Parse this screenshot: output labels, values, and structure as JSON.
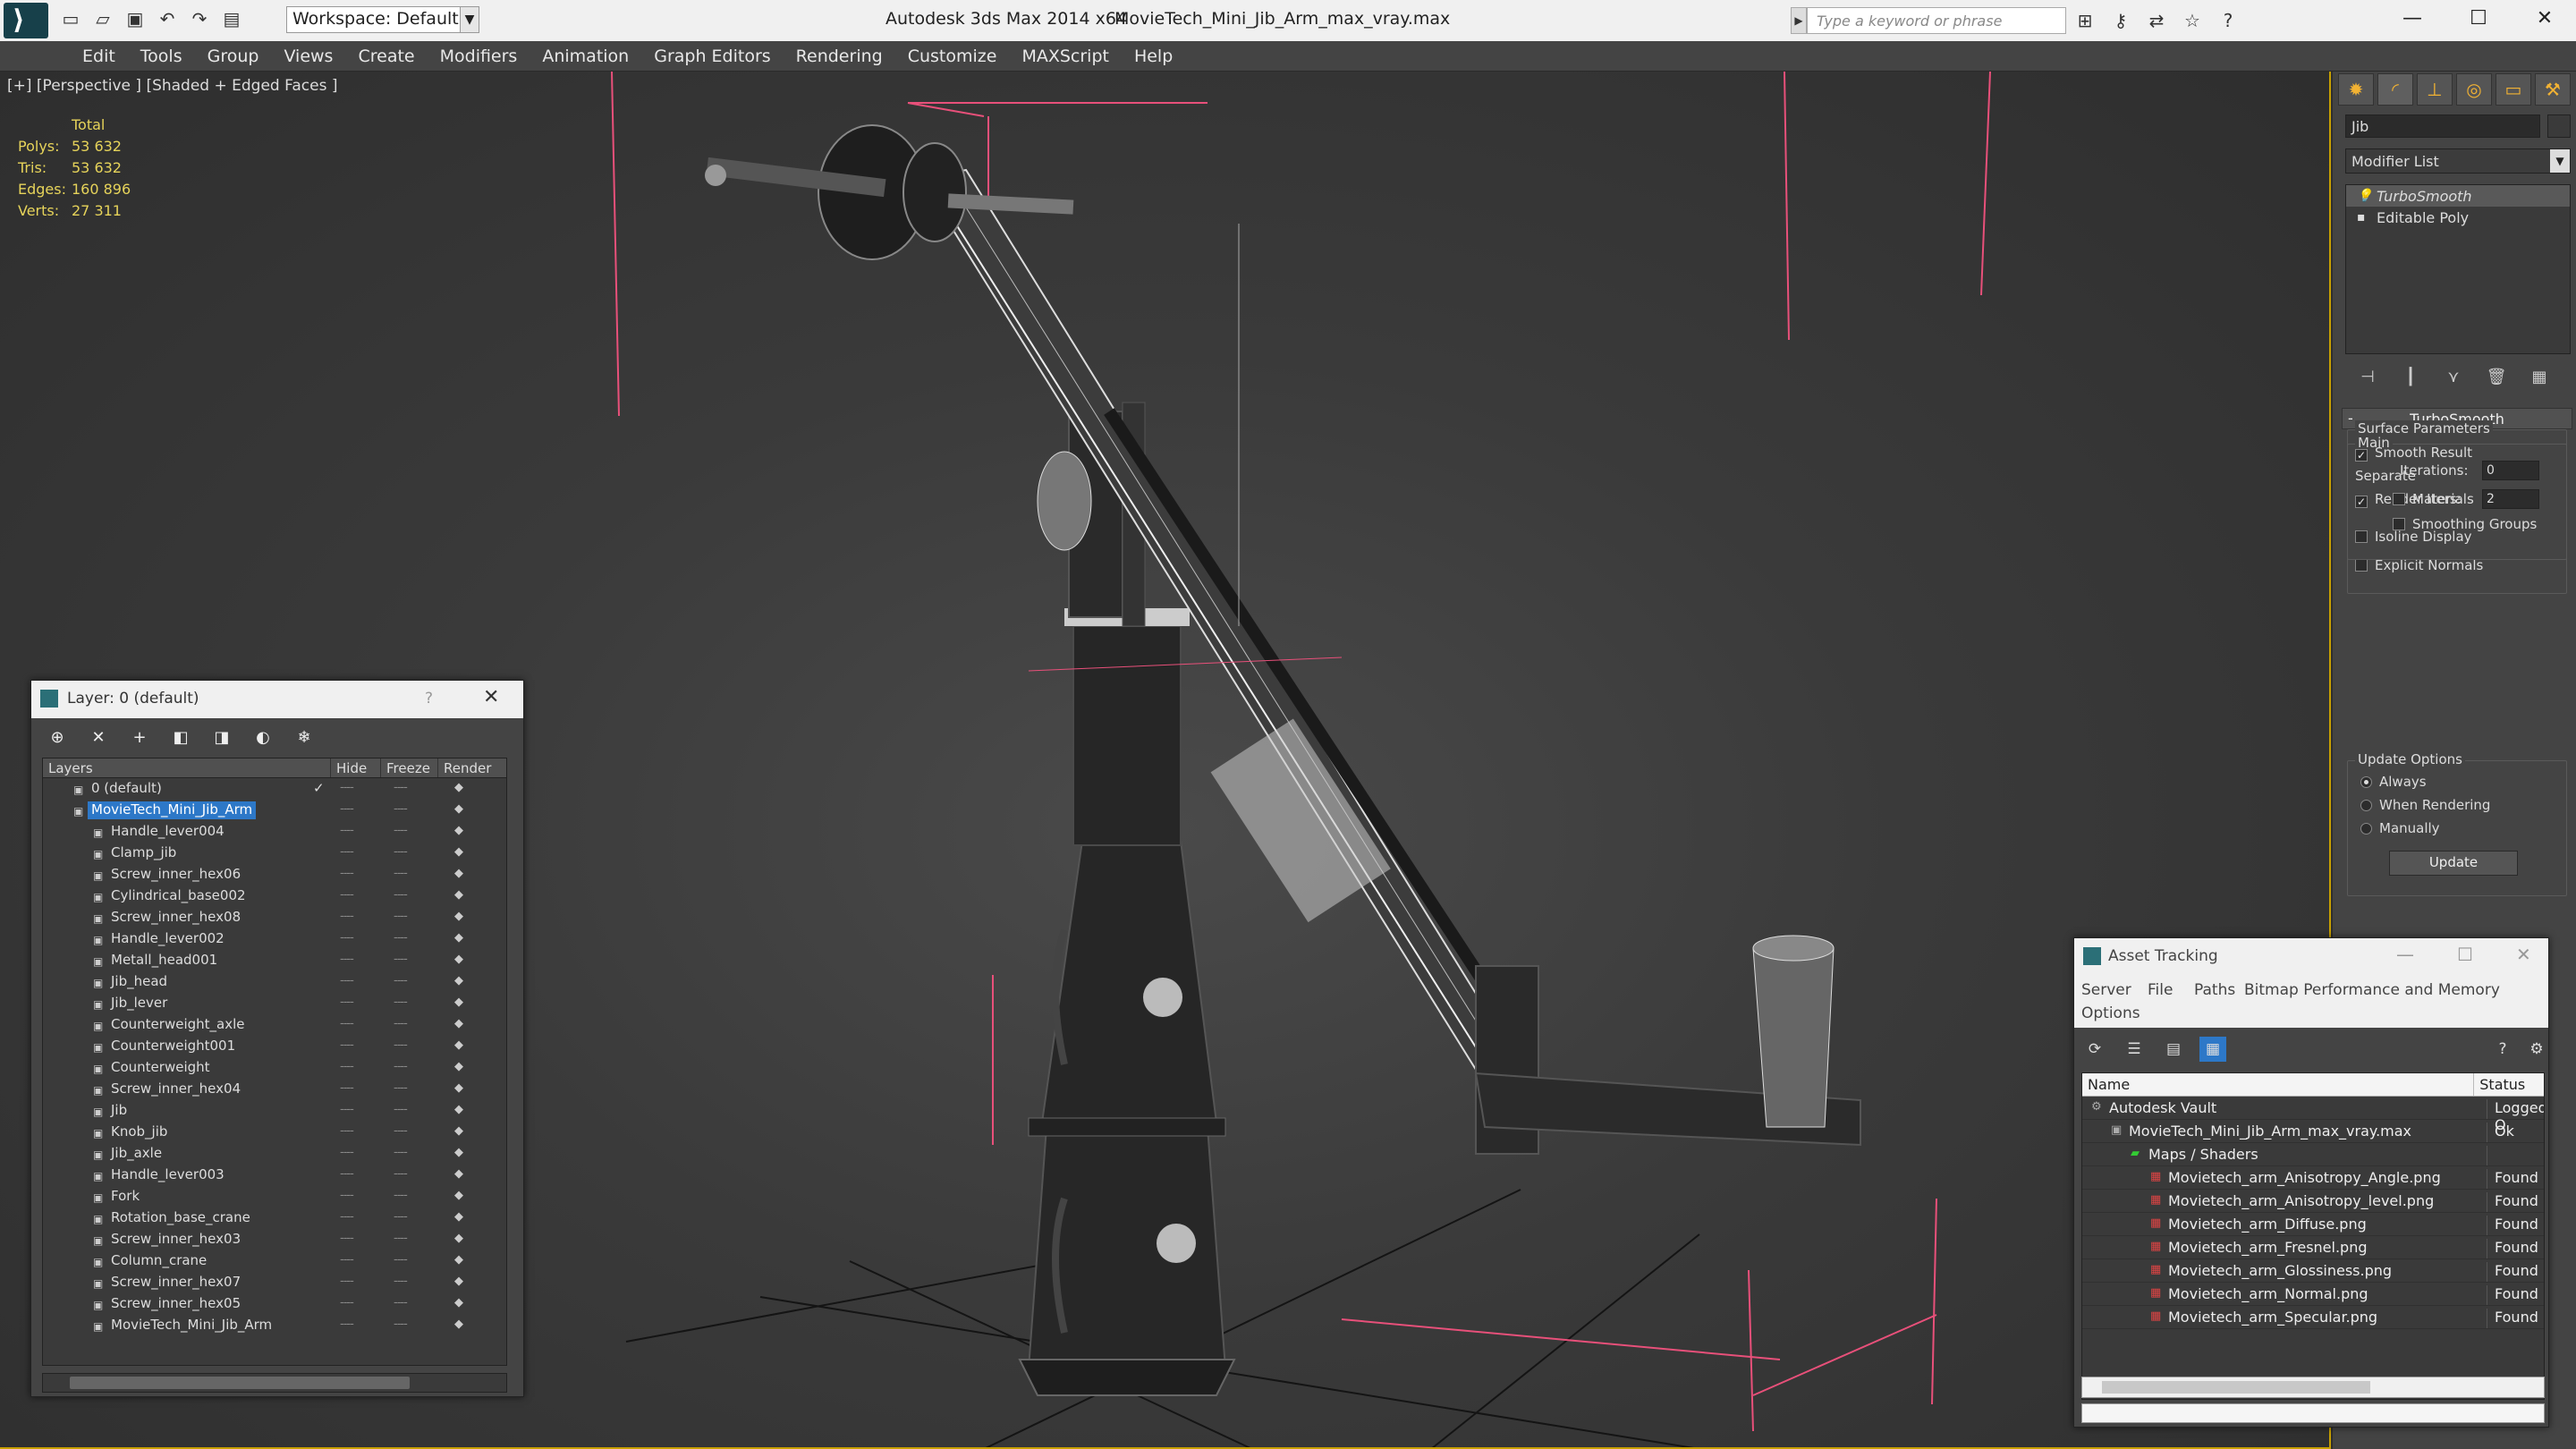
{
  "window": {
    "app_title": "Autodesk 3ds Max  2014 x64",
    "file_title": "MovieTech_Mini_Jib_Arm_max_vray.max",
    "workspace": "Workspace: Default",
    "search_placeholder": "Type a keyword or phrase",
    "quick_access_icons": [
      "new-file-icon",
      "open-file-icon",
      "save-icon",
      "undo-icon",
      "redo-icon",
      "hold-icon"
    ],
    "toolbar_icons": [
      "binoculars-icon",
      "key-icon",
      "exchange-icon",
      "star-icon",
      "help-icon"
    ],
    "controls": {
      "minimize": "—",
      "maximize": "☐",
      "close": "✕"
    }
  },
  "menu": [
    "Edit",
    "Tools",
    "Group",
    "Views",
    "Create",
    "Modifiers",
    "Animation",
    "Graph Editors",
    "Rendering",
    "Customize",
    "MAXScript",
    "Help"
  ],
  "viewport": {
    "label": "[+] [Perspective ] [Shaded + Edged Faces ]",
    "stats_header": "Total",
    "stats": [
      {
        "key": "Polys:",
        "value": "53 632"
      },
      {
        "key": "Tris:",
        "value": "53 632"
      },
      {
        "key": "Edges:",
        "value": "160 896"
      },
      {
        "key": "Verts:",
        "value": "27 311"
      }
    ]
  },
  "command_panel": {
    "object_name": "Jib",
    "modifier_list": "Modifier List",
    "stack": [
      {
        "label": "TurboSmooth",
        "selected": true
      },
      {
        "label": "Editable Poly",
        "selected": false
      }
    ],
    "rollout_title": "TurboSmooth",
    "main_group": "Main",
    "iterations_label": "Iterations:",
    "iterations_value": "0",
    "render_iters_label": "Render Iters:",
    "render_iters_value": "2",
    "isoline_display": "Isoline Display",
    "explicit_normals": "Explicit Normals",
    "surface_params": "Surface Parameters",
    "smooth_result": "Smooth Result",
    "separate": "Separate",
    "materials": "Materials",
    "smoothing_groups": "Smoothing Groups",
    "update_options": "Update Options",
    "always": "Always",
    "when_rendering": "When Rendering",
    "manually": "Manually",
    "update_button": "Update"
  },
  "layer_dialog": {
    "title": "Layer: 0 (default)",
    "help": "?",
    "columns": [
      "Layers",
      "Hide",
      "Freeze",
      "Render"
    ],
    "default_layer": "0 (default)",
    "selected_layer": "MovieTech_Mini_Jib_Arm",
    "objects": [
      "Handle_lever004",
      "Clamp_jib",
      "Screw_inner_hex06",
      "Cylindrical_base002",
      "Screw_inner_hex08",
      "Handle_lever002",
      "Metall_head001",
      "Jib_head",
      "Jib_lever",
      "Counterweight_axle",
      "Counterweight001",
      "Counterweight",
      "Screw_inner_hex04",
      "Jib",
      "Knob_jib",
      "Jib_axle",
      "Handle_lever003",
      "Fork",
      "Rotation_base_crane",
      "Screw_inner_hex03",
      "Column_crane",
      "Screw_inner_hex07",
      "Screw_inner_hex05",
      "MovieTech_Mini_Jib_Arm"
    ],
    "hide_mark": "----",
    "freeze_mark": "----",
    "render_mark": "◆"
  },
  "asset_tracking": {
    "title": "Asset Tracking",
    "menu": [
      "Server",
      "File",
      "Paths",
      "Bitmap Performance and Memory",
      "Options"
    ],
    "columns": [
      "Name",
      "Status"
    ],
    "rows": [
      {
        "name": "Autodesk Vault",
        "status": "Logged O",
        "indent": 0
      },
      {
        "name": "MovieTech_Mini_Jib_Arm_max_vray.max",
        "status": "Ok",
        "indent": 1
      },
      {
        "name": "Maps / Shaders",
        "status": "",
        "indent": 2
      },
      {
        "name": "Movietech_arm_Anisotropy_Angle.png",
        "status": "Found",
        "indent": 3
      },
      {
        "name": "Movietech_arm_Anisotropy_level.png",
        "status": "Found",
        "indent": 3
      },
      {
        "name": "Movietech_arm_Diffuse.png",
        "status": "Found",
        "indent": 3
      },
      {
        "name": "Movietech_arm_Fresnel.png",
        "status": "Found",
        "indent": 3
      },
      {
        "name": "Movietech_arm_Glossiness.png",
        "status": "Found",
        "indent": 3
      },
      {
        "name": "Movietech_arm_Normal.png",
        "status": "Found",
        "indent": 3
      },
      {
        "name": "Movietech_arm_Specular.png",
        "status": "Found",
        "indent": 3
      }
    ]
  },
  "colors": {
    "accent": "#2d78c8",
    "viewport_border": "#c8a000",
    "stats": "#e6d35a",
    "gizmo_pink": "#e8507a"
  }
}
